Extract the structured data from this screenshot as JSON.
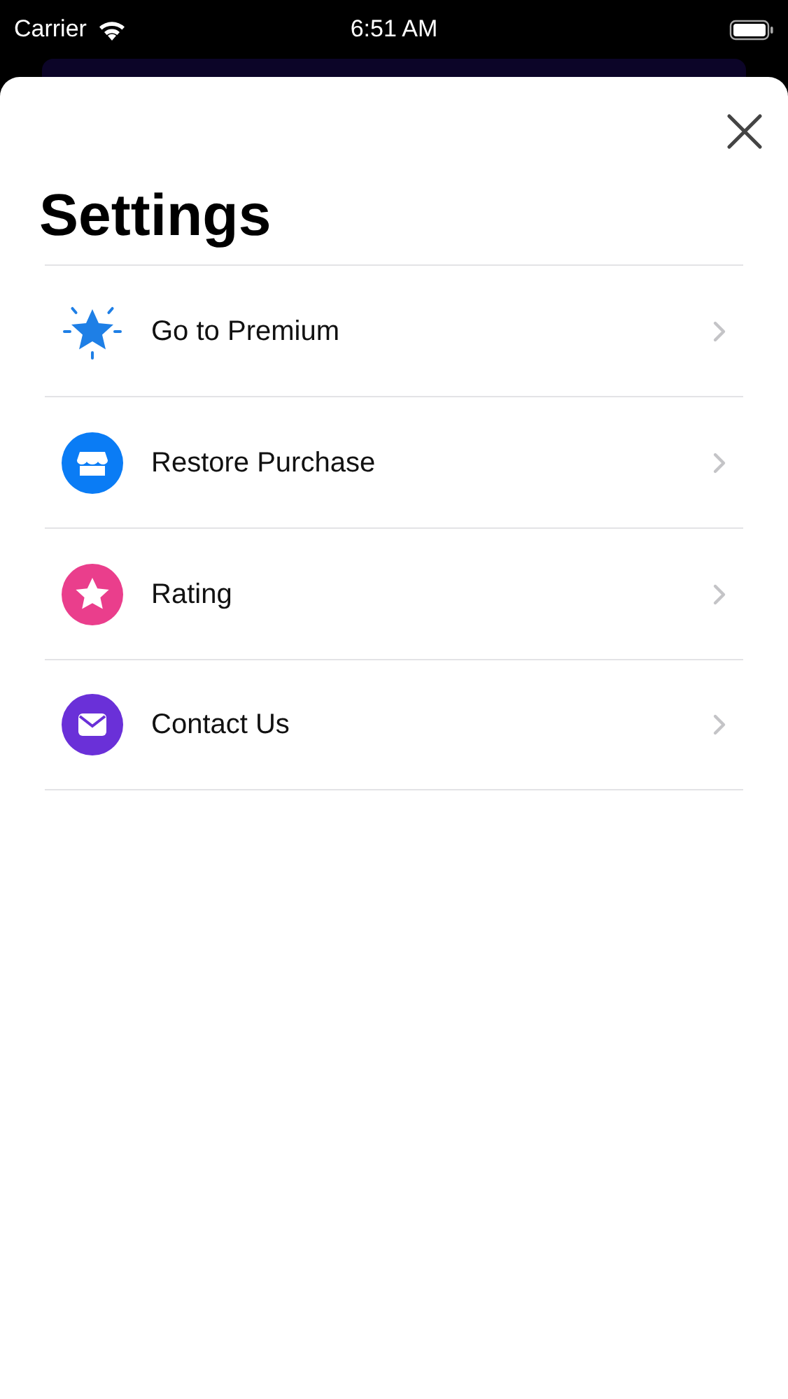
{
  "status_bar": {
    "carrier": "Carrier",
    "time": "6:51 AM"
  },
  "title": "Settings",
  "items": [
    {
      "label": "Go to Premium",
      "kind": "premium",
      "color": "#1e7fe6"
    },
    {
      "label": "Restore Purchase",
      "kind": "store",
      "color": "#0a7cf5"
    },
    {
      "label": "Rating",
      "kind": "rating",
      "color": "#ea3e8c"
    },
    {
      "label": "Contact Us",
      "kind": "contact",
      "color": "#6a30d8"
    }
  ]
}
